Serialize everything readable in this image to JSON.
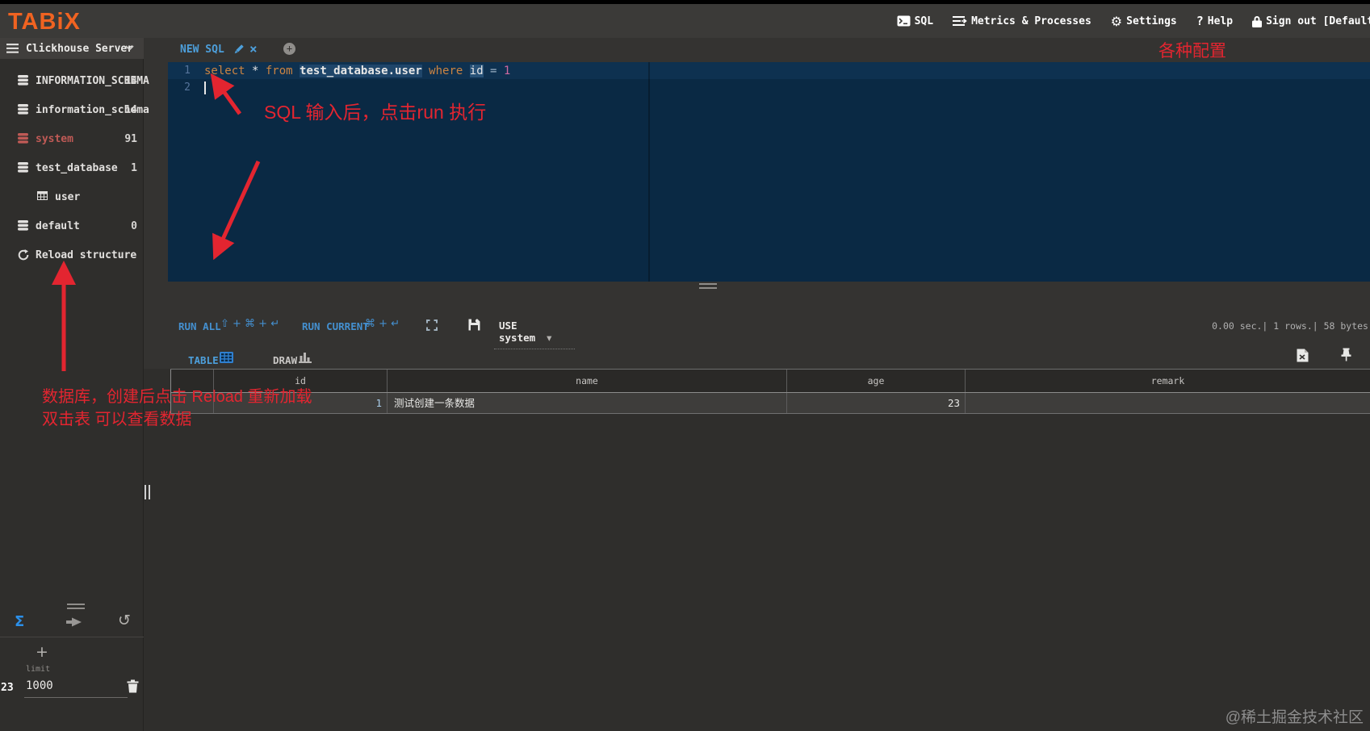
{
  "colors": {
    "accent_blue": "#4d9fdb",
    "logo_orange": "#f06321",
    "annotation_red": "#e32530",
    "system_red": "#c05a56",
    "editor_bg": "#0a2944"
  },
  "topbar": {
    "logo": "TABiX",
    "menu": {
      "sql": "SQL",
      "metrics": "Metrics & Processes",
      "settings": "Settings",
      "help": "Help",
      "signout": "Sign out [Default]"
    }
  },
  "icons": {
    "help_q": "?",
    "gear": "⚙",
    "close": "×",
    "plus_tab": "+",
    "dropdown_arrow": "▾",
    "history": "↺",
    "sigma": "Σ"
  },
  "sidebar": {
    "server_label": "Clickhouse Server",
    "items": [
      {
        "label": "INFORMATION_SCHEMA",
        "count": "14"
      },
      {
        "label": "information_schema",
        "count": "14"
      },
      {
        "label": "system",
        "count": "91"
      },
      {
        "label": "test_database",
        "count": "1"
      },
      {
        "label": "user",
        "count": ""
      },
      {
        "label": "default",
        "count": "0"
      },
      {
        "label": "Reload structure",
        "count": ""
      }
    ],
    "footer": {
      "rows_badge": "23",
      "plus": "+",
      "limit_label": "limit",
      "limit_value": "1000"
    }
  },
  "editor": {
    "tab_label": "NEW SQL",
    "line_numbers": [
      "1",
      "2"
    ],
    "sql": {
      "kw1": "select ",
      "star": "* ",
      "kw2": "from ",
      "table": "test_database.user",
      "kw3": " where ",
      "col": "id",
      "eq": " = ",
      "val": "1"
    }
  },
  "toolbar": {
    "run_all": "RUN ALL",
    "run_all_keys": "⇧ + ⌘ + ↵",
    "run_current": "RUN CURRENT",
    "run_current_keys": "⌘ + ↵",
    "use_db": "USE system",
    "stats": "0.00 sec.| 1 rows.| 58 bytes"
  },
  "results": {
    "tab_table": "TABLE",
    "tab_draw": "DRAW",
    "table": {
      "headers": [
        "id",
        "name",
        "age",
        "remark"
      ],
      "rows": [
        [
          "1",
          "测试创建一条数据",
          "23",
          ""
        ]
      ]
    }
  },
  "annotations": {
    "config": "各种配置",
    "run_note": "SQL 输入后，点击run 执行",
    "reload_note": "数据库，创建后点击 Reload 重新加载",
    "dblclick_note": "双击表 可以查看数据"
  },
  "watermark": "@稀土掘金技术社区"
}
